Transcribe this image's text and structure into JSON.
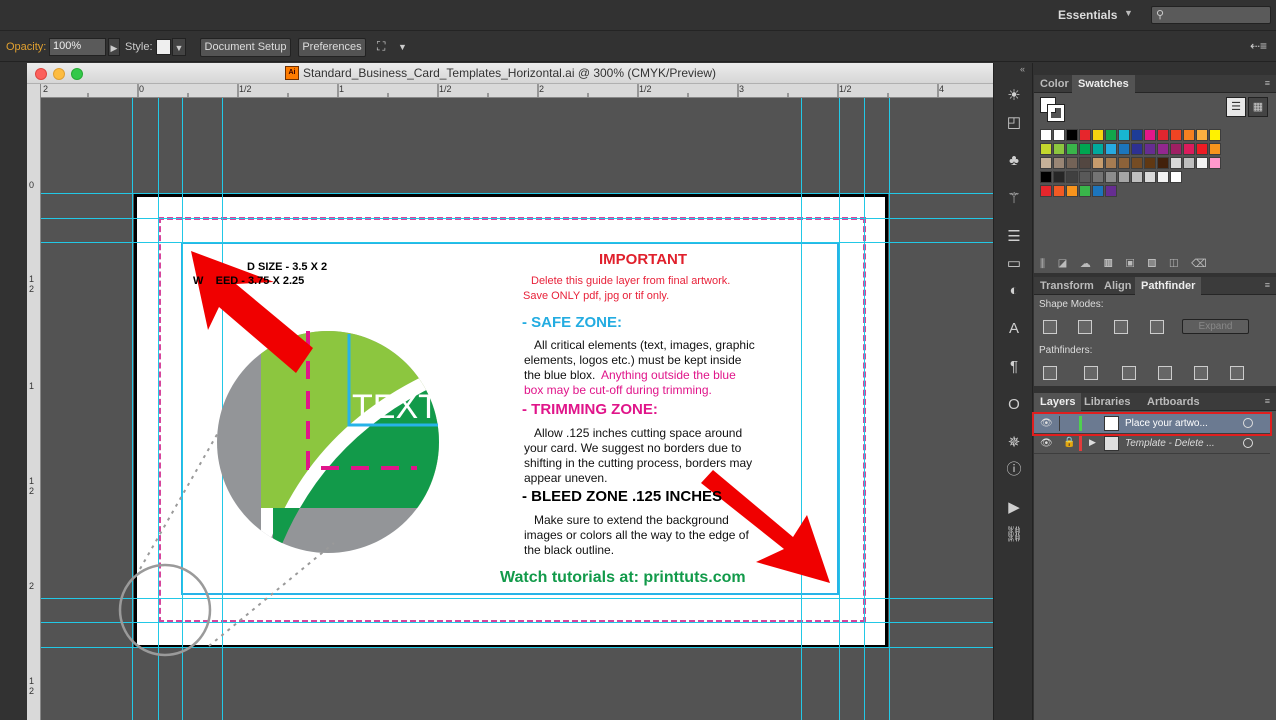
{
  "workspace": {
    "label": "Essentials",
    "search_placeholder": ""
  },
  "control_bar": {
    "opacity_label": "Opacity:",
    "opacity_value": "100%",
    "style_label": "Style:",
    "document_setup": "Document Setup",
    "preferences": "Preferences"
  },
  "document": {
    "title": "Standard_Business_Card_Templates_Horizontal.ai @ 300% (CMYK/Preview)",
    "app_icon": "Ai"
  },
  "ruler": {
    "h_labels": [
      "2",
      "0",
      "1/2",
      "1",
      "1/2",
      "2",
      "1/2",
      "3",
      "1/2",
      "4"
    ],
    "v_labels": [
      "0",
      "1",
      "2",
      "1",
      "1",
      "2",
      "2",
      "1",
      "2"
    ]
  },
  "card": {
    "size_line_1": "D SIZE - 3.5 X 2",
    "size_line_2": "W    EED - 3.75 X 2.25",
    "circle_text": "TEXT",
    "important_title": "IMPORTANT",
    "important_line_1": "Delete this guide layer from final artwork.",
    "important_line_2": "Save ONLY pdf, jpg or tif only.",
    "safe_title": "- SAFE ZONE:",
    "safe_l1": "All critical elements (text, images, graphic",
    "safe_l2": "elements, logos etc.) must be kept inside",
    "safe_l3": "the blue blox.",
    "safe_l3b": "Anything outside the blue",
    "safe_l4": "box may be cut-off during trimming.",
    "trim_title": "- TRIMMING ZONE:",
    "trim_l1": "Allow .125 inches cutting space around",
    "trim_l2": "your card. We suggest no borders due to",
    "trim_l3": "shifting in the cutting process, borders may",
    "trim_l4": "appear uneven.",
    "bleed_title": "- BLEED ZONE .125 INCHES",
    "bleed_l1": "Make sure to extend the background",
    "bleed_l2": "images or colors all the way to the edge of",
    "bleed_l3": "the black outline.",
    "footer": "Watch tutorials at: printtuts.com"
  },
  "color_panel": {
    "tab_color": "Color",
    "tab_swatches": "Swatches"
  },
  "swatch_rows": [
    [
      "#ffffff",
      "#ffffff",
      "#000000",
      "#e6262c",
      "#f5d410",
      "#11a64b",
      "#18b6d2",
      "#1d3c97",
      "#e3178a",
      "#e0262f",
      "#ef4423",
      "#f58020",
      "#fbb040",
      "#fff200"
    ],
    [
      "#c4d82d",
      "#8dc63f",
      "#39b54a",
      "#00a651",
      "#00a99d",
      "#27aae1",
      "#1c75bc",
      "#2e3192",
      "#662d91",
      "#92278f",
      "#9e1f63",
      "#da1c5c",
      "#ed1c24",
      "#f7941d"
    ],
    [
      "#c7b299",
      "#998675",
      "#736357",
      "#534741",
      "#c69c6d",
      "#a67c52",
      "#8c6239",
      "#754c24",
      "#603813",
      "#42210b",
      "#d9d9d9",
      "#bfbfbf",
      "#f2f2f2",
      "#ff99cc"
    ],
    [
      "#000000",
      "#262626",
      "#404040",
      "#595959",
      "#737373",
      "#8c8c8c",
      "#a6a6a6",
      "#bfbfbf",
      "#d9d9d9",
      "#f2f2f2",
      "#ffffff"
    ],
    [
      "#e6262c",
      "#f15a24",
      "#f7941d",
      "#39b54a",
      "#1c75bc",
      "#662d91"
    ]
  ],
  "pathfinder_panel": {
    "tab_transform": "Transform",
    "tab_align": "Align",
    "tab_pathfinder": "Pathfinder",
    "shape_modes": "Shape Modes:",
    "expand": "Expand",
    "pathfinders": "Pathfinders:"
  },
  "layers_panel": {
    "tab_layers": "Layers",
    "tab_libraries": "Libraries",
    "tab_artboards": "Artboards",
    "layers": [
      {
        "name": "Place your artwo...",
        "color": "#4fd04f",
        "selected": true
      },
      {
        "name": "Template - Delete ...",
        "color": "#e33c3c",
        "selected": false
      }
    ]
  }
}
